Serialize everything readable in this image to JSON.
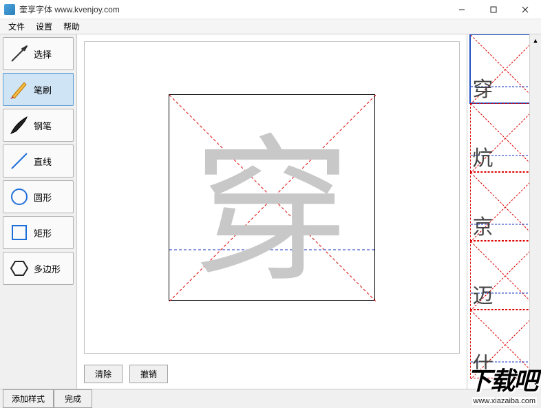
{
  "window": {
    "title": "奎享字体 www.kvenjoy.com"
  },
  "menu": {
    "file": "文件",
    "settings": "设置",
    "help": "帮助"
  },
  "tools": {
    "select": "选择",
    "brush": "笔刷",
    "pen": "钢笔",
    "line": "直线",
    "circle": "圆形",
    "rect": "矩形",
    "polygon": "多边形"
  },
  "canvas": {
    "current_char": "穿"
  },
  "actions": {
    "clear": "清除",
    "undo": "撤销"
  },
  "char_list": [
    {
      "char": "穿",
      "selected": true
    },
    {
      "char": "炕",
      "selected": false
    },
    {
      "char": "京",
      "selected": false
    },
    {
      "char": "迈",
      "selected": false
    },
    {
      "char": "仕",
      "selected": false
    }
  ],
  "bottom": {
    "add_style": "添加样式",
    "done": "完成"
  },
  "watermark": {
    "text": "下载吧",
    "url": "www.xiazaiba.com"
  }
}
